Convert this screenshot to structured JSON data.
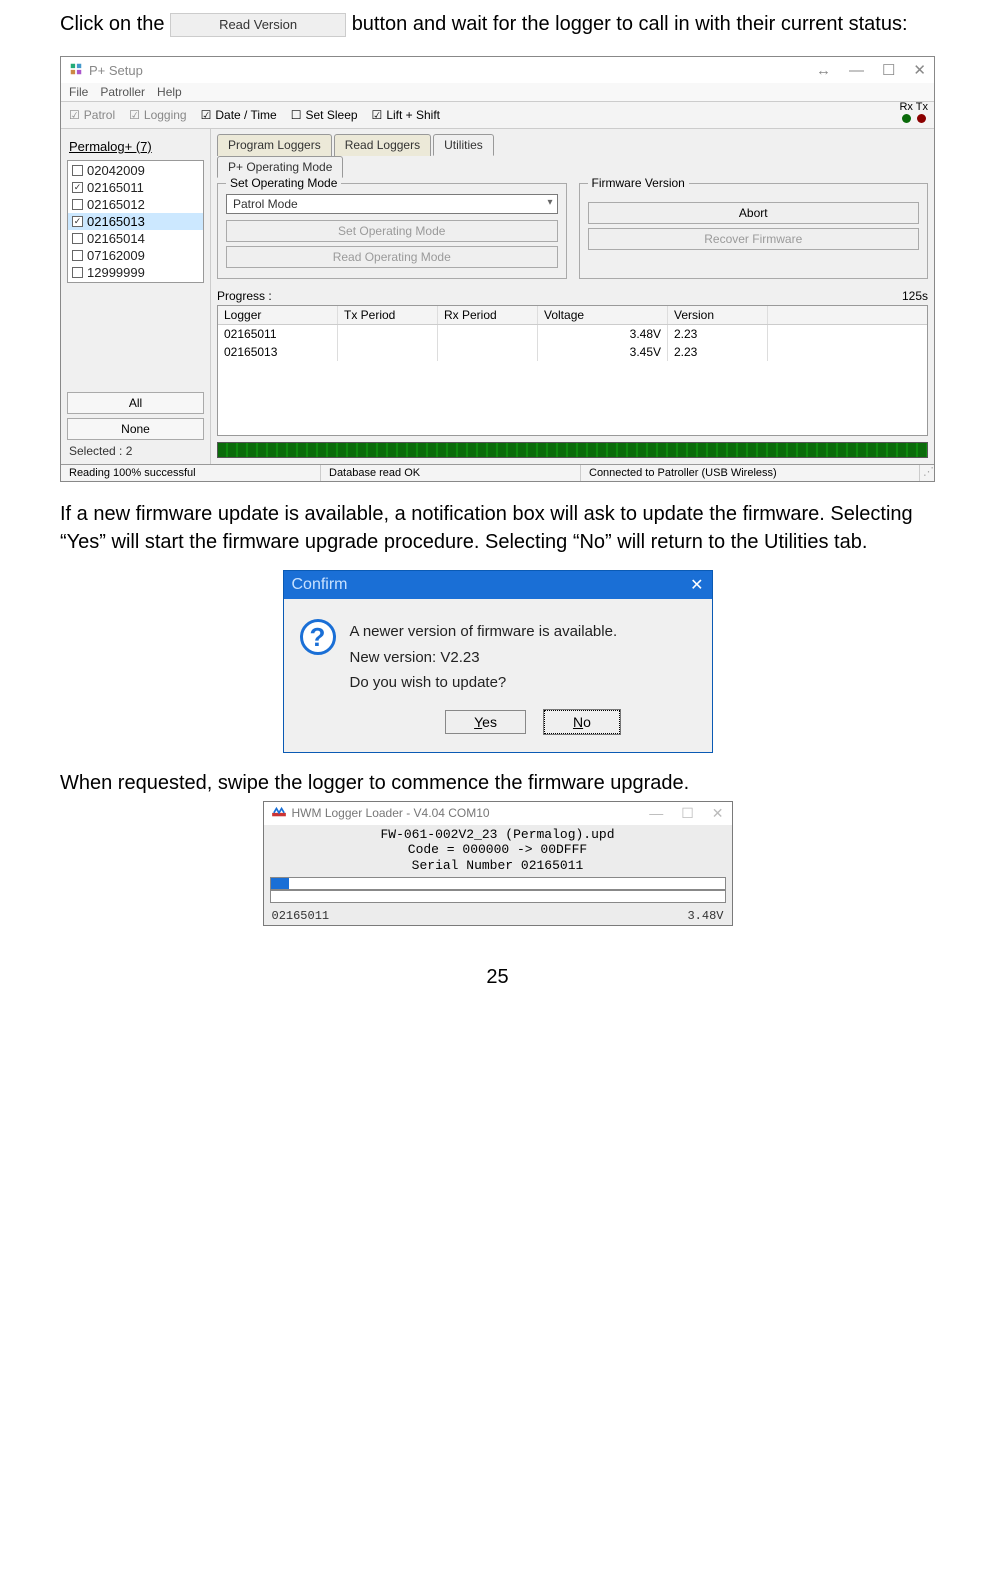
{
  "intro": {
    "pre": "Click on the",
    "button_label": "Read Version",
    "post": "button and wait for the logger to call in with their current status:"
  },
  "app": {
    "title": "P+ Setup",
    "menu": {
      "file": "File",
      "patroller": "Patroller",
      "help": "Help"
    },
    "toolbar": {
      "patrol": "Patrol",
      "logging": "Logging",
      "datetime": "Date / Time",
      "setsleep": "Set Sleep",
      "liftshift": "Lift + Shift",
      "rx": "Rx",
      "tx": "Tx"
    },
    "sidebar": {
      "title": "Permalog+ (7)",
      "items": [
        {
          "id": "02042009",
          "checked": false,
          "selected": false
        },
        {
          "id": "02165011",
          "checked": true,
          "selected": false
        },
        {
          "id": "02165012",
          "checked": false,
          "selected": false
        },
        {
          "id": "02165013",
          "checked": true,
          "selected": true
        },
        {
          "id": "02165014",
          "checked": false,
          "selected": false
        },
        {
          "id": "07162009",
          "checked": false,
          "selected": false
        },
        {
          "id": "12999999",
          "checked": false,
          "selected": false
        }
      ],
      "all": "All",
      "none": "None",
      "selected_label": "Selected : 2"
    },
    "tabs": {
      "program": "Program Loggers",
      "read": "Read Loggers",
      "utilities": "Utilities",
      "operating": "P+ Operating Mode"
    },
    "set_mode": {
      "legend": "Set Operating Mode",
      "value": "Patrol Mode",
      "btn_set": "Set Operating Mode",
      "btn_read": "Read Operating Mode"
    },
    "firmware": {
      "legend": "Firmware Version",
      "abort": "Abort",
      "recover": "Recover Firmware"
    },
    "progress_label": "Progress :",
    "progress_time": "125s",
    "table": {
      "headers": {
        "logger": "Logger",
        "tx": "Tx Period",
        "rx": "Rx Period",
        "voltage": "Voltage",
        "version": "Version"
      },
      "rows": [
        {
          "logger": "02165011",
          "tx": "",
          "rx": "",
          "voltage": "3.48V",
          "version": "2.23"
        },
        {
          "logger": "02165013",
          "tx": "",
          "rx": "",
          "voltage": "3.45V",
          "version": "2.23"
        }
      ]
    },
    "statusbar": {
      "s1": "Reading 100% successful",
      "s2": "Database read OK",
      "s3": "Connected to Patroller (USB Wireless)"
    }
  },
  "body_text": "If a new firmware update is available, a notification box will ask to update the firmware. Selecting “Yes” will start the firmware upgrade procedure. Selecting “No” will return to the Utilities tab.",
  "confirm": {
    "title": "Confirm",
    "line1": "A newer version of firmware is available.",
    "line2": "New version: V2.23",
    "line3": "Do you wish to update?",
    "yes": "Yes",
    "no": "No"
  },
  "swipe_text": "When requested, swipe the logger to commence the firmware upgrade.",
  "loader": {
    "title": "HWM Logger Loader  - V4.04 COM10",
    "line1": "FW-061-002V2_23 (Permalog).upd",
    "line2": "Code = 000000 -> 00DFFF",
    "line3": "Serial Number 02165011",
    "bottom_id": "02165011",
    "bottom_volt": "3.48V"
  },
  "page_number": "25"
}
